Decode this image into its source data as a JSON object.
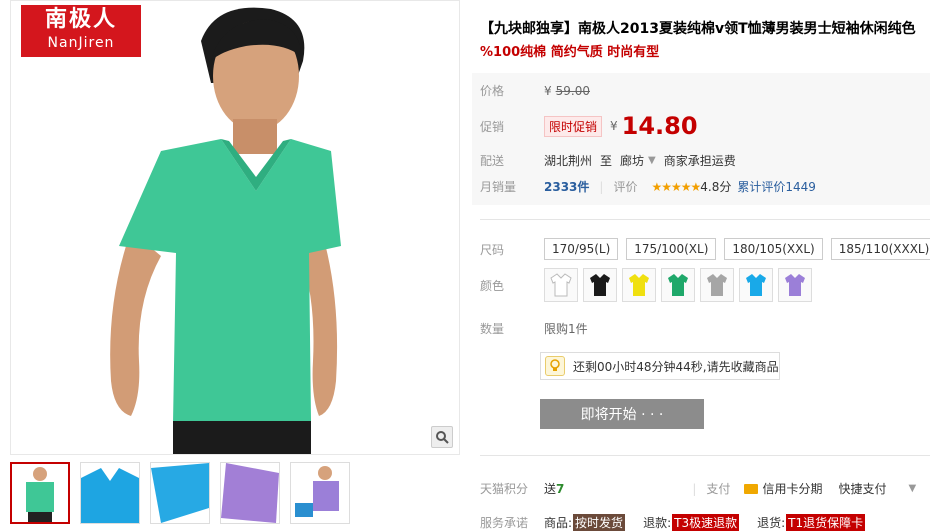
{
  "brand": {
    "logo_cn": "南极人",
    "logo_en": "NanJiren"
  },
  "product": {
    "title": "【九块邮独享】南极人2013夏装纯棉v领T恤薄男装男士短袖休闲纯色",
    "subtitle": "%100纯棉 简约气质 时尚有型"
  },
  "price": {
    "label": "价格",
    "currency": "¥",
    "original": "59.00",
    "promo_label": "促销",
    "promo_badge": "限时促销",
    "current": "14.80"
  },
  "shipping": {
    "label": "配送",
    "from": "湖北荆州",
    "to_word": "至",
    "destination": "廊坊",
    "fee_note": "商家承担运费"
  },
  "sales": {
    "label": "月销量",
    "count": "2333件",
    "rating_label": "评价",
    "stars": "★★★★★",
    "score": "4.8分",
    "cumulative": "累计评价1449"
  },
  "sizes": {
    "label": "尺码",
    "options": [
      "170/95(L)",
      "175/100(XL)",
      "180/105(XXL)",
      "185/110(XXXL)"
    ]
  },
  "colors": {
    "label": "颜色",
    "swatches": [
      "#ffffff",
      "#1a1a1a",
      "#f0e010",
      "#1fa86a",
      "#a6a6a6",
      "#19a9e8",
      "#9b7fd8"
    ]
  },
  "quantity": {
    "label": "数量",
    "limit": "限购1件"
  },
  "timer": {
    "text": "还剩00小时48分钟44秒,请先收藏商品"
  },
  "buy_button": {
    "label": "即将开始 · · ·"
  },
  "points": {
    "label": "天猫积分",
    "send": "送",
    "value": "7",
    "pay_label": "支付",
    "credit": "信用卡分期",
    "quick": "快捷支付"
  },
  "service": {
    "label": "服务承诺",
    "goods": "商品:",
    "goods_tag": "按时发货",
    "refund": "退款:",
    "refund_tag": "T3极速退款",
    "return": "退货:",
    "return_tag": "T1退货保障卡"
  },
  "accent": "#c40000"
}
